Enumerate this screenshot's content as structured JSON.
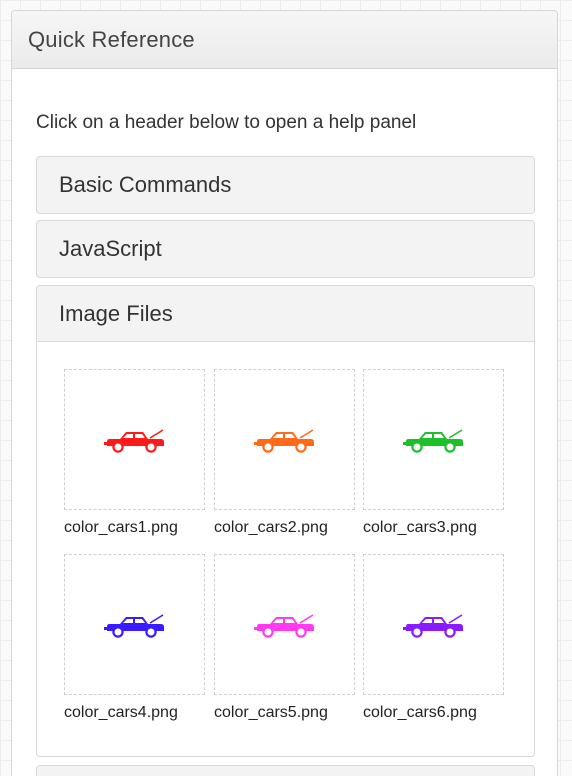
{
  "panel": {
    "title": "Quick Reference",
    "intro": "Click on a header below to open a help panel"
  },
  "accordion": [
    {
      "label": "Basic Commands",
      "open": false
    },
    {
      "label": "JavaScript",
      "open": false
    },
    {
      "label": "Image Files",
      "open": true
    }
  ],
  "image_files": [
    {
      "name": "color_cars1.png",
      "icon": "car-icon",
      "color": "#ff1a1a"
    },
    {
      "name": "color_cars2.png",
      "icon": "car-icon",
      "color": "#ff6a1a"
    },
    {
      "name": "color_cars3.png",
      "icon": "car-icon",
      "color": "#1dbf2a"
    },
    {
      "name": "color_cars4.png",
      "icon": "car-icon",
      "color": "#3a1aff"
    },
    {
      "name": "color_cars5.png",
      "icon": "car-icon",
      "color": "#ff3af0"
    },
    {
      "name": "color_cars6.png",
      "icon": "car-icon",
      "color": "#8a1aff"
    }
  ]
}
